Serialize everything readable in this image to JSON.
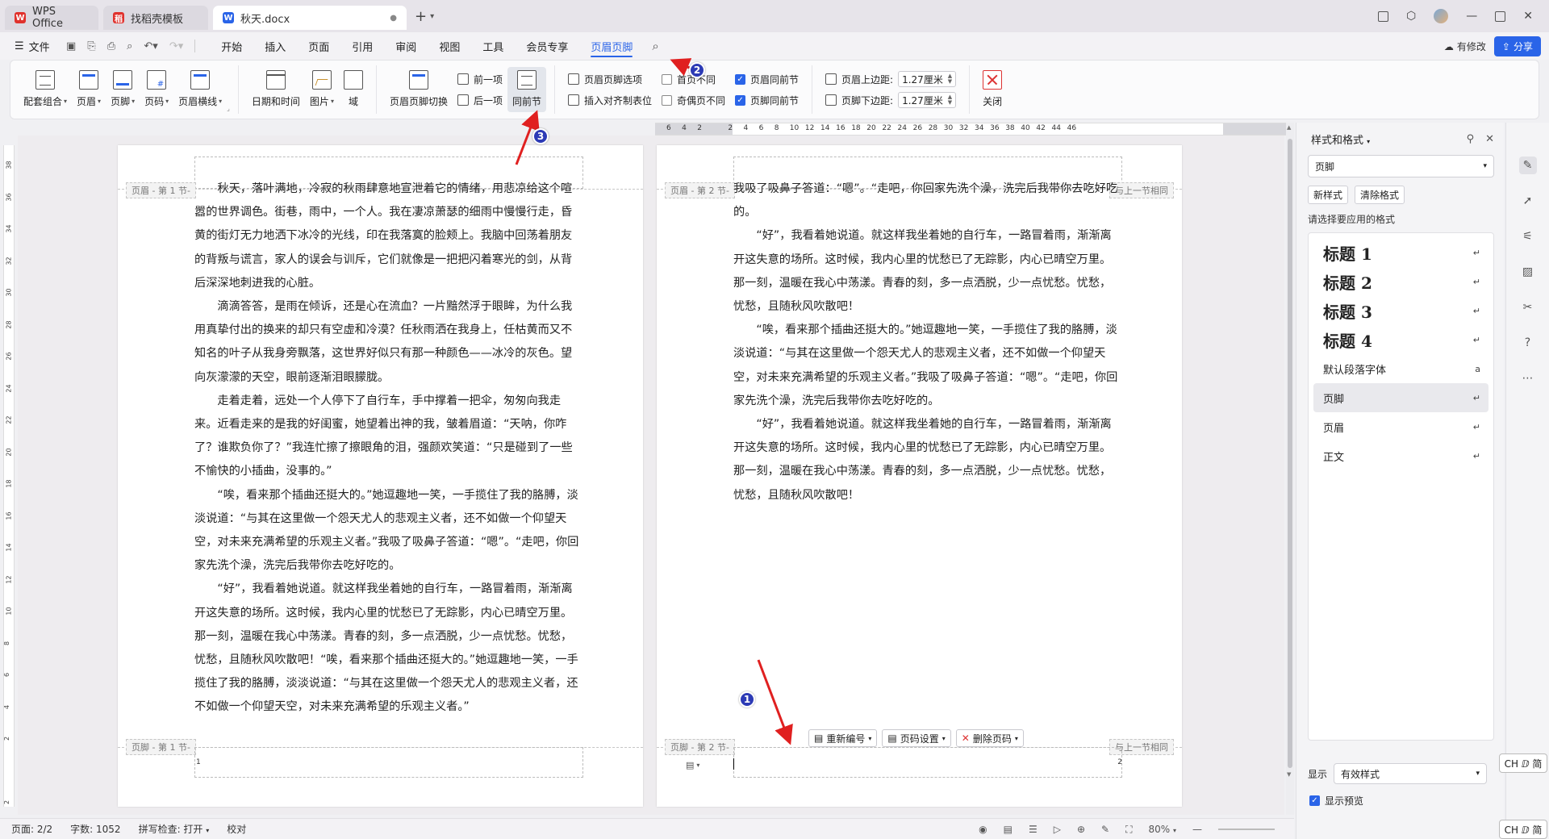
{
  "tabs": [
    {
      "label": "WPS Office",
      "icon": "wps-logo-icon"
    },
    {
      "label": "找稻壳模板",
      "icon": "template-icon"
    },
    {
      "label": "秋天.docx",
      "icon": "word-doc-icon",
      "active": true
    }
  ],
  "menu": {
    "file_label": "文件",
    "items": [
      "开始",
      "插入",
      "页面",
      "引用",
      "审阅",
      "视图",
      "工具",
      "会员专享",
      "页眉页脚"
    ],
    "active": "页眉页脚",
    "modify_label": "有修改",
    "share_label": "分享"
  },
  "ribbon": {
    "g1": [
      "配套组合",
      "页眉",
      "页脚",
      "页码",
      "页眉横线"
    ],
    "g2": [
      "日期和时间",
      "图片",
      "域"
    ],
    "g3_big": "页眉页脚切换",
    "prev_label": "前一项",
    "next_label": "后一项",
    "same_prev_label": "同前节",
    "options_label": "页眉页脚选项",
    "insert_align_label": "插入对齐制表位",
    "first_diff_label": "首页不同",
    "odd_even_label": "奇偶页不同",
    "header_same_label": "页眉同前节",
    "footer_same_label": "页脚同前节",
    "header_top_label": "页眉上边距:",
    "header_top_value": "1.27厘米",
    "footer_bottom_label": "页脚下边距:",
    "footer_bottom_value": "1.27厘米",
    "close_label": "关闭"
  },
  "ruler": {
    "h_labels": [
      "6",
      "4",
      "2",
      "",
      "2",
      "4",
      "6",
      "8",
      "10",
      "12",
      "14",
      "16",
      "18",
      "20",
      "22",
      "24",
      "26",
      "28",
      "30",
      "32",
      "34",
      "36",
      "38",
      "40",
      "42",
      "44",
      "46"
    ],
    "v_labels": [
      "38",
      "36",
      "34",
      "32",
      "30",
      "28",
      "26",
      "24",
      "22",
      "20",
      "18",
      "16",
      "14",
      "12",
      "10",
      "8",
      "6",
      "4",
      "2",
      "",
      "2"
    ]
  },
  "page1": {
    "header_tag": "页眉 - 第 1 节-",
    "footer_tag": "页脚 - 第 1 节-",
    "page_number": "1",
    "paragraphs": [
      "秋天，落叶满地，冷寂的秋雨肆意地宣泄着它的情绪，用悲凉给这个喧嚣的世界调色。街巷，雨中，一个人。我在凄凉萧瑟的细雨中慢慢行走，昏黄的街灯无力地洒下冰冷的光线，印在我落寞的脸颊上。我脑中回荡着朋友的背叛与谎言，家人的误会与训斥，它们就像是一把把闪着寒光的剑，从背后深深地刺进我的心脏。",
      "滴滴答答，是雨在倾诉，还是心在流血？一片黯然浮于眼眸，为什么我用真挚付出的换来的却只有空虚和冷漠？任秋雨洒在我身上，任枯黄而又不知名的叶子从我身旁飘落，这世界好似只有那一种颜色——冰冷的灰色。望向灰濛濛的天空，眼前逐渐泪眼朦胧。",
      "走着走着，远处一个人停下了自行车，手中撑着一把伞，匆匆向我走来。近看走来的是我的好闺蜜，她望着出神的我，皱着眉道：“天呐，你咋了？谁欺负你了？”我连忙擦了擦眼角的泪，强颜欢笑道：“只是碰到了一些不愉快的小插曲，没事的。”",
      "“唉，看来那个插曲还挺大的。”她逗趣地一笑，一手揽住了我的胳膊，淡淡说道：“与其在这里做一个怨天尤人的悲观主义者，还不如做一个仰望天空，对未来充满希望的乐观主义者。”我吸了吸鼻子答道：“嗯”。“走吧，你回家先洗个澡，洗完后我带你去吃好吃的。",
      "“好”，我看着她说道。就这样我坐着她的自行车，一路冒着雨，渐渐离开这失意的场所。这时候，我内心里的忧愁已了无踪影，内心已晴空万里。那一刻，温暖在我心中荡漾。青春的刻，多一点洒脱，少一点忧愁。忧愁，忧愁，且随秋风吹散吧！“唉，看来那个插曲还挺大的。”她逗趣地一笑，一手揽住了我的胳膊，淡淡说道：“与其在这里做一个怨天尤人的悲观主义者，还不如做一个仰望天空，对未来充满希望的乐观主义者。”"
    ]
  },
  "page2": {
    "header_tag": "页眉 - 第 2 节-",
    "footer_tag": "页脚 - 第 2 节-",
    "same_prev_tag": "与上一节相同",
    "page_number": "2",
    "paragraphs": [
      "我吸了吸鼻子答道：“嗯”。“走吧，你回家先洗个澡，洗完后我带你去吃好吃的。",
      "“好”，我看着她说道。就这样我坐着她的自行车，一路冒着雨，渐渐离开这失意的场所。这时候，我内心里的忧愁已了无踪影，内心已晴空万里。那一刻，温暖在我心中荡漾。青春的刻，多一点洒脱，少一点忧愁。忧愁，忧愁，且随秋风吹散吧！",
      "“唉，看来那个插曲还挺大的。”她逗趣地一笑，一手揽住了我的胳膊，淡淡说道：“与其在这里做一个怨天尤人的悲观主义者，还不如做一个仰望天空，对未来充满希望的乐观主义者。”我吸了吸鼻子答道：“嗯”。“走吧，你回家先洗个澡，洗完后我带你去吃好吃的。",
      "“好”，我看着她说道。就这样我坐着她的自行车，一路冒着雨，渐渐离开这失意的场所。这时候，我内心里的忧愁已了无踪影，内心已晴空万里。那一刻，温暖在我心中荡漾。青春的刻，多一点洒脱，少一点忧愁。忧愁，忧愁，且随秋风吹散吧！"
    ],
    "footer_tools": [
      "重新编号",
      "页码设置",
      "删除页码"
    ]
  },
  "annotations": [
    "1",
    "2",
    "3"
  ],
  "panel": {
    "title": "样式和格式",
    "current_style": "页脚",
    "new_style": "新样式",
    "clear_format": "清除格式",
    "caption": "请选择要应用的格式",
    "styles": [
      {
        "label": "标题  1",
        "kind": "h"
      },
      {
        "label": "标题  2",
        "kind": "h"
      },
      {
        "label": "标题  3",
        "kind": "h"
      },
      {
        "label": "标题 4",
        "kind": "h"
      },
      {
        "label": "默认段落字体",
        "kind": "n"
      },
      {
        "label": "页脚",
        "kind": "n",
        "selected": true
      },
      {
        "label": "页眉",
        "kind": "n"
      },
      {
        "label": "正文",
        "kind": "n"
      }
    ],
    "show_label": "显示",
    "show_value": "有效样式",
    "preview_label": "显示预览"
  },
  "ime": "CH ⅅ 简",
  "status": {
    "page": "页面: 2/2",
    "words": "字数: 1052",
    "spell": "拼写检查: 打开",
    "proof": "校对",
    "zoom": "80%"
  },
  "colors": {
    "accent": "#2a64e8",
    "badge": "#2c3ab5",
    "arrow": "#e02020"
  }
}
